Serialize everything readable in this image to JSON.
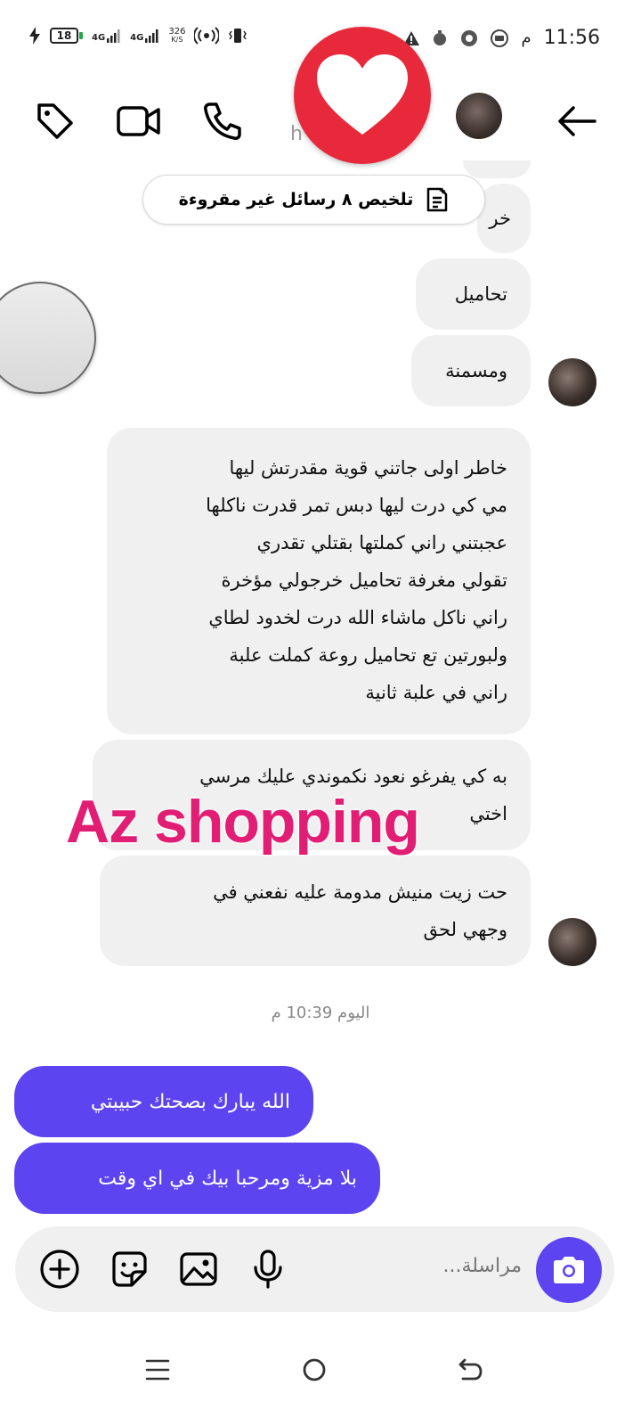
{
  "status_bar": {
    "battery": "18",
    "network_1": "4G",
    "network_2": "4G",
    "speed_value": "326",
    "speed_unit": "K/S",
    "time": "11:56",
    "time_suffix": "م"
  },
  "header": {
    "name_fragment": "h"
  },
  "summary_pill": {
    "label": "تلخيص ٨ رسائل غير مقروءة"
  },
  "messages": {
    "partial": "خر",
    "m1": "تحاميل",
    "m2": "ومسمنة",
    "m3": [
      "خاطر اولى جاتني قوية مقدرتش ليها",
      "مي كي درت ليها دبس تمر قدرت ناكلها",
      "عجبتني راني كملتها بقتلي تقدري",
      "تقولي مغرفة  تحاميل خرجولي مؤخرة",
      "راني ناكل ماشاء الله درت لخدود لطاي",
      "ولبورتين تع تحاميل روعة كملت علبة",
      "راني في علبة ثانية"
    ],
    "m4": [
      "به كي يفرغو نعود نكموندي عليك مرسي",
      "اختي"
    ],
    "m5": [
      "حت زيت منيش مدومة عليه نفعني في",
      "وجهي لحق"
    ]
  },
  "timestamp": "اليوم 10:39 م",
  "sent": {
    "s1": "الله يبارك بصحتك حبيبتي",
    "s2": "بلا مزية ومرحبا بيك في اي وقت"
  },
  "watermark": "Az shopping",
  "composer": {
    "placeholder": "مراسلة..."
  },
  "colors": {
    "accent": "#5c44f0",
    "heart_badge": "#e8293c",
    "watermark": "#e11d74",
    "bubble_bg": "#f0f0f0"
  }
}
